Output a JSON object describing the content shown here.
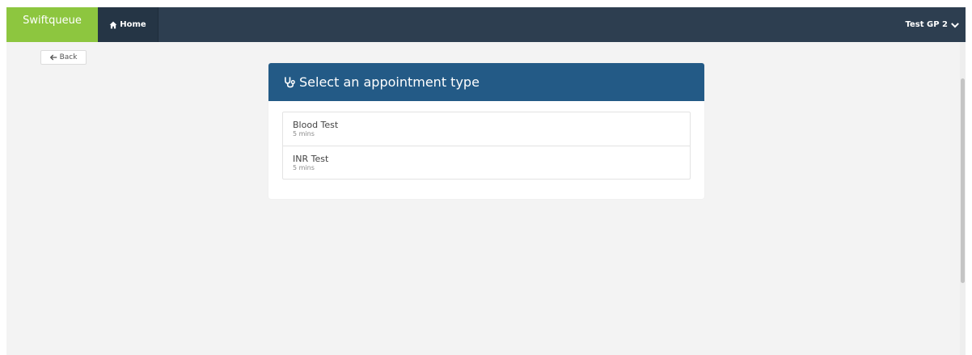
{
  "navbar": {
    "brand": "Swiftqueue",
    "home_label": "Home",
    "user_label": "Test GP 2",
    "colors": {
      "bar": "#2d3e50",
      "brand": "#8dc63f"
    },
    "icons": {
      "home": "home-icon",
      "user_menu": "chevron-down-icon"
    }
  },
  "back_button": {
    "label": "Back",
    "icon": "arrow-left-icon"
  },
  "panel": {
    "title": "Select an appointment type",
    "icon": "stethoscope-icon",
    "header_color": "#235a86",
    "items": [
      {
        "name": "Blood Test",
        "duration": "5 mins"
      },
      {
        "name": "INR Test",
        "duration": "5 mins"
      }
    ]
  }
}
